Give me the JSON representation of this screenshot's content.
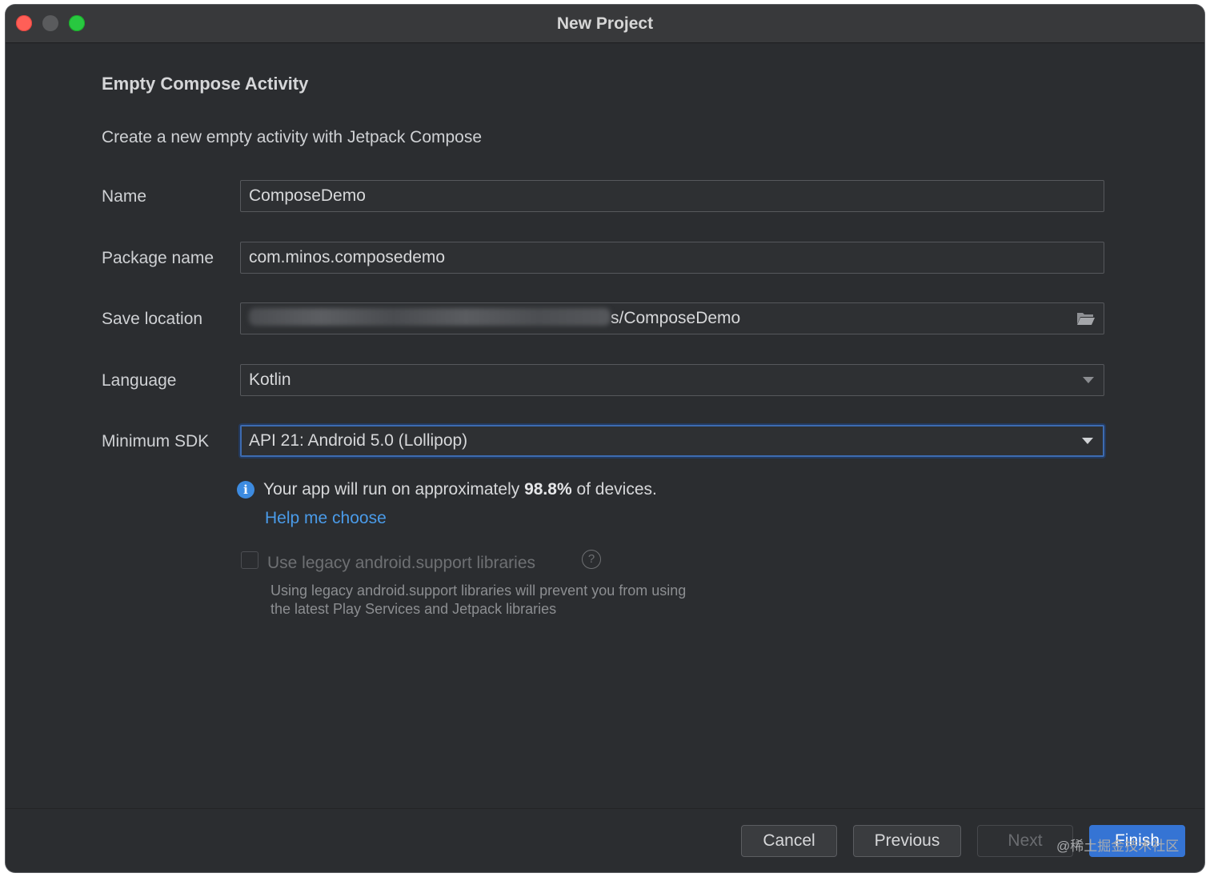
{
  "window": {
    "title": "New Project"
  },
  "page": {
    "heading": "Empty Compose Activity",
    "description": "Create a new empty activity with Jetpack Compose"
  },
  "form": {
    "name": {
      "label": "Name",
      "value": "ComposeDemo"
    },
    "package": {
      "label": "Package name",
      "value": "com.minos.composedemo"
    },
    "save_location": {
      "label": "Save location",
      "value_suffix": "s/ComposeDemo",
      "icon": "folder-open-icon"
    },
    "language": {
      "label": "Language",
      "value": "Kotlin"
    },
    "min_sdk": {
      "label": "Minimum SDK",
      "value": "API 21: Android 5.0 (Lollipop)"
    }
  },
  "info": {
    "prefix": "Your app will run on approximately ",
    "percent": "98.8%",
    "suffix": " of devices.",
    "help_link": "Help me choose"
  },
  "legacy": {
    "checked": false,
    "label": "Use legacy android.support libraries",
    "hint_line1": "Using legacy android.support libraries will prevent you from using",
    "hint_line2": "the latest Play Services and Jetpack libraries"
  },
  "buttons": {
    "cancel": "Cancel",
    "previous": "Previous",
    "next": "Next",
    "finish": "Finish"
  },
  "watermark": "@稀土掘金技术社区",
  "colors": {
    "background": "#2b2d30",
    "accent": "#3574d4",
    "link": "#4a9be9",
    "focus_border": "#3d6bb0"
  }
}
